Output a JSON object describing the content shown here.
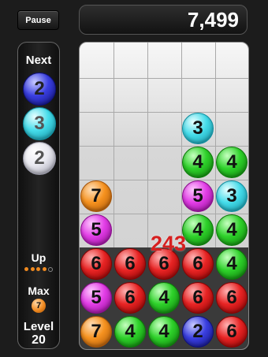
{
  "pause_label": "Pause",
  "score": "7,499",
  "side": {
    "next_label": "Next",
    "next": [
      {
        "value": "2",
        "color": "blue"
      },
      {
        "value": "3",
        "color": "cyan"
      },
      {
        "value": "2",
        "color": "white"
      }
    ],
    "up_label": "Up",
    "up_progress": {
      "filled": 4,
      "total": 5
    },
    "max_label": "Max",
    "max_value": "7",
    "level_label": "Level",
    "level": "20"
  },
  "board": {
    "columns": 5,
    "rows": 9,
    "cells": [
      [
        null,
        null,
        null,
        null,
        null
      ],
      [
        null,
        null,
        null,
        null,
        null
      ],
      [
        null,
        null,
        null,
        {
          "value": "3",
          "color": "cyan"
        },
        null
      ],
      [
        null,
        null,
        null,
        {
          "value": "4",
          "color": "green"
        },
        {
          "value": "4",
          "color": "green"
        }
      ],
      [
        {
          "value": "7",
          "color": "orange"
        },
        null,
        null,
        {
          "value": "5",
          "color": "magenta"
        },
        {
          "value": "3",
          "color": "cyan"
        }
      ],
      [
        {
          "value": "5",
          "color": "magenta"
        },
        null,
        null,
        {
          "value": "4",
          "color": "green"
        },
        {
          "value": "4",
          "color": "green"
        }
      ],
      [
        {
          "value": "6",
          "color": "red"
        },
        {
          "value": "6",
          "color": "red"
        },
        {
          "value": "6",
          "color": "red"
        },
        {
          "value": "6",
          "color": "red"
        },
        {
          "value": "4",
          "color": "green"
        }
      ],
      [
        {
          "value": "5",
          "color": "magenta"
        },
        {
          "value": "6",
          "color": "red"
        },
        {
          "value": "4",
          "color": "green"
        },
        {
          "value": "6",
          "color": "red"
        },
        {
          "value": "6",
          "color": "red"
        }
      ],
      [
        {
          "value": "7",
          "color": "orange"
        },
        {
          "value": "4",
          "color": "green"
        },
        {
          "value": "4",
          "color": "green"
        },
        {
          "value": "2",
          "color": "blue"
        },
        {
          "value": "6",
          "color": "red"
        }
      ]
    ],
    "popup_score": "243"
  },
  "colors": {
    "red": [
      "#ffb3b3",
      "#e82424",
      "#8a0000"
    ],
    "green": [
      "#c6ffc0",
      "#2ed12a",
      "#0b7a08"
    ],
    "cyan": [
      "#e9ffff",
      "#45dcea",
      "#0e8ea0"
    ],
    "magenta": [
      "#ffc9ff",
      "#e23de6",
      "#8a0a8c"
    ],
    "orange": [
      "#ffe1bd",
      "#f6921f",
      "#a65206"
    ],
    "blue": [
      "#c8cbff",
      "#3a3fe0",
      "#0d0f7a"
    ],
    "white": [
      "#ffffff",
      "#e9e9f0",
      "#9797a6"
    ]
  }
}
